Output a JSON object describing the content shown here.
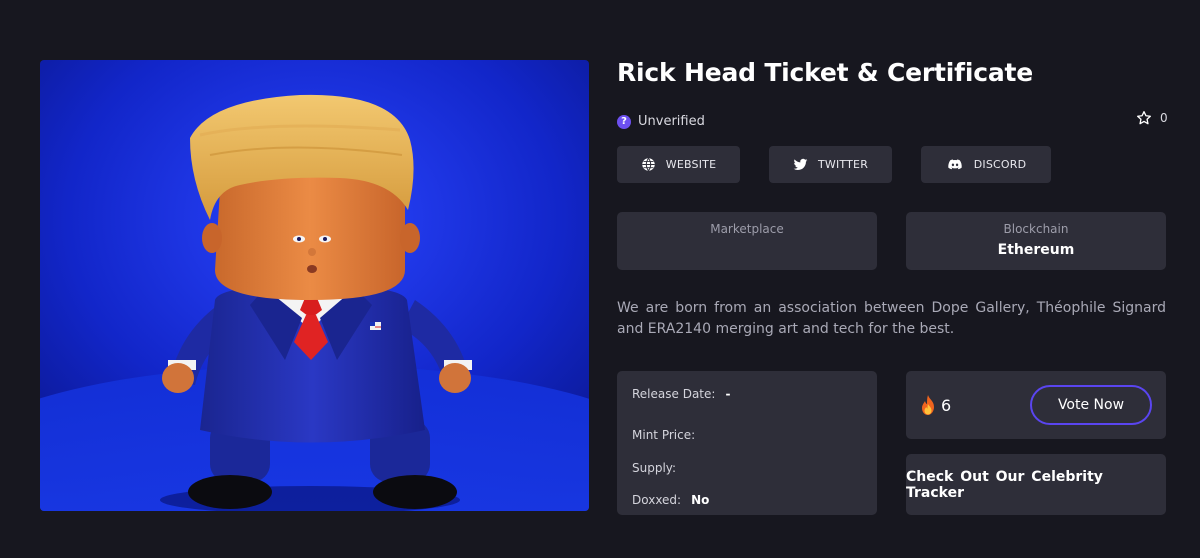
{
  "collection": {
    "title": "Rick Head Ticket & Certificate",
    "verification_status": "Unverified",
    "favorites_count": "0",
    "description": "We are born from an association between Dope Gallery, Théophile Signard and ERA2140 merging art and tech for the best."
  },
  "links": {
    "website_label": "WEBSITE",
    "twitter_label": "TWITTER",
    "discord_label": "DISCORD"
  },
  "info": {
    "marketplace_label": "Marketplace",
    "marketplace_value": "",
    "blockchain_label": "Blockchain",
    "blockchain_value": "Ethereum"
  },
  "details": {
    "release_date_label": "Release Date:",
    "release_date_value": "-",
    "mint_price_label": "Mint Price:",
    "mint_price_value": "",
    "supply_label": "Supply:",
    "supply_value": "",
    "doxxed_label": "Doxxed:",
    "doxxed_value": "No"
  },
  "voting": {
    "count": "6",
    "vote_button_label": "Vote Now"
  },
  "tracker": {
    "label": "Check Out Our Celebrity Tracker"
  },
  "icons": {
    "verify": "question-circle-icon",
    "favorite": "star-outline-icon",
    "website": "globe-icon",
    "twitter": "twitter-bird-icon",
    "discord": "discord-icon",
    "votes": "fire-icon"
  },
  "colors": {
    "background": "#17171f",
    "card": "#2e2e39",
    "accent": "#5a45f0",
    "verify_badge": "#6d50f0",
    "artwork_background": "#1226c9"
  }
}
